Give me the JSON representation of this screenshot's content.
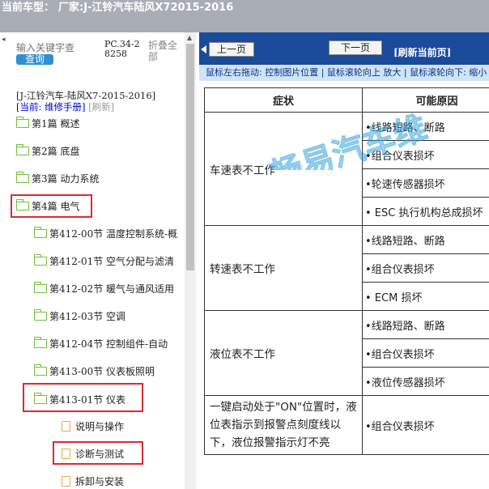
{
  "topbar": {
    "label": "当前车型：",
    "model": "厂家:J-江铃汽车陆风X72015-2016"
  },
  "sidebar": {
    "search_placeholder": "输入关键字查",
    "query_label": "查询",
    "pc_code": "PC.34-28258",
    "collapse_all": "折叠全部",
    "book_title": "[J-江铃汽车-陆风X7-2015-2016]",
    "current_label": "[当前: 维修手册]",
    "refresh_label": "[刷新]",
    "items": [
      {
        "label": "第1篇 概述",
        "type": "folder"
      },
      {
        "label": "第2篇 底盘",
        "type": "folder"
      },
      {
        "label": "第3篇 动力系统",
        "type": "folder"
      },
      {
        "label": "第4篇 电气",
        "type": "folder"
      },
      {
        "label": "第412-00节 温度控制系统-概",
        "type": "folder"
      },
      {
        "label": "第412-01节 空气分配与滤清",
        "type": "folder"
      },
      {
        "label": "第412-02节 暖气与通风适用",
        "type": "folder"
      },
      {
        "label": "第412-03节 空调",
        "type": "folder"
      },
      {
        "label": "第412-04节 控制组件-自动",
        "type": "folder"
      },
      {
        "label": "第413-00节 仪表板照明",
        "type": "folder"
      },
      {
        "label": "第413-01节 仪表",
        "type": "folder"
      },
      {
        "label": "说明与操作",
        "type": "file"
      },
      {
        "label": "诊断与测试",
        "type": "file"
      },
      {
        "label": "拆卸与安装",
        "type": "file"
      }
    ]
  },
  "nav": {
    "prev_label": "上一页",
    "next_label": "下一页",
    "refresh_current": "[刷新当前页]",
    "hint": "鼠标左右拖动: 控制图片位置 | 鼠标滚轮向上 放大 | 鼠标滚轮向下: 缩小"
  },
  "table": {
    "headers": {
      "symptom": "症状",
      "cause": "可能原因"
    },
    "rows": [
      {
        "symptom": "车速表不工作",
        "causes": [
          "•线路短路、断路",
          "•组合仪表损坏",
          "•轮速传感器损坏",
          "• ESC 执行机构总成损坏"
        ]
      },
      {
        "symptom": "转速表不工作",
        "causes": [
          "•线路短路、断路",
          "•组合仪表损坏",
          "• ECM 损坏"
        ]
      },
      {
        "symptom": "液位表不工作",
        "causes": [
          "•线路短路、断路",
          "•组合仪表损坏",
          "•液位传感器损坏"
        ]
      },
      {
        "symptom": "一键启动处于\"ON\"位置时，液位表指示到报警点刻度线以下，液位报警指示灯不亮",
        "causes": [
          "•组合仪表损坏"
        ]
      }
    ]
  },
  "watermark": {
    "text": "畅易汽车维"
  },
  "colors": {
    "highlight": "#e0282e",
    "navbar": "#1a4a9a",
    "hintbar": "#d0e4f7",
    "query": "#2f8fd2"
  }
}
